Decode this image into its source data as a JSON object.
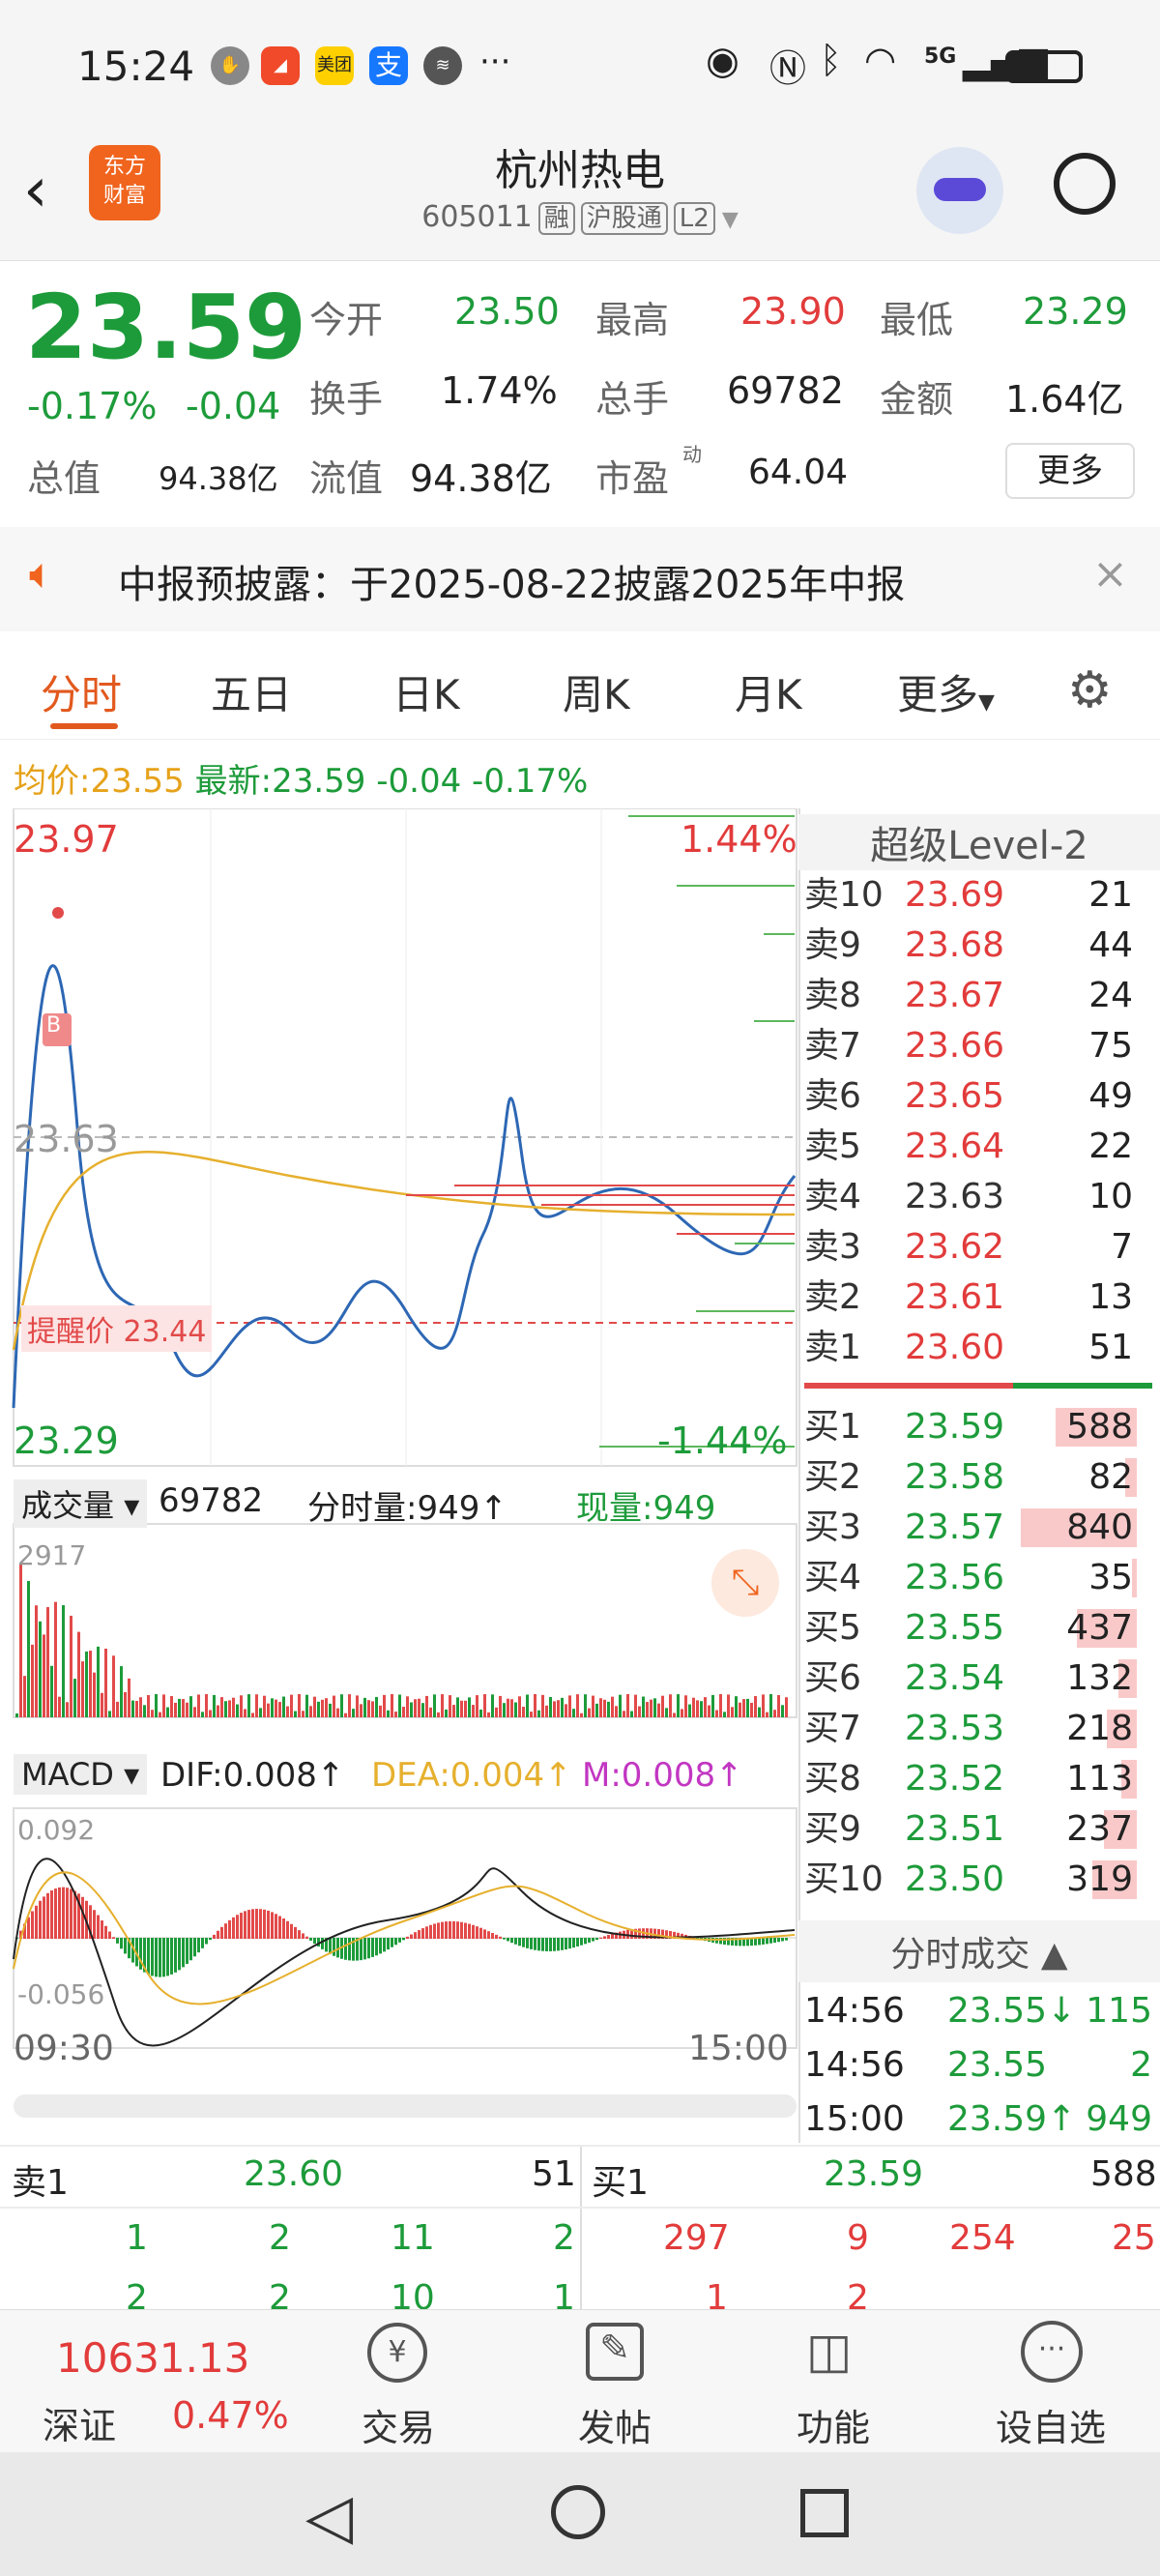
{
  "status": {
    "time": "15:24",
    "app1": "美团",
    "app2": "支",
    "net": "5G"
  },
  "header": {
    "logo": "东方\n财富",
    "title": "杭州热电",
    "code": "605011",
    "tags": [
      "融",
      "沪股通",
      "L2"
    ]
  },
  "quote": {
    "price": "23.59",
    "chg_pct": "-0.17%",
    "chg": "-0.04",
    "open_l": "今开",
    "open": "23.50",
    "high_l": "最高",
    "high": "23.90",
    "low_l": "最低",
    "low": "23.29",
    "turn_l": "换手",
    "turn": "1.74%",
    "vol_l": "总手",
    "vol": "69782",
    "amt_l": "金额",
    "amt": "1.64亿",
    "mcap_l": "总值",
    "mcap": "94.38亿",
    "fcap_l": "流值",
    "fcap": "94.38亿",
    "pe_l": "市盈",
    "pe_sup": "动",
    "pe": "64.04",
    "more": "更多"
  },
  "notice": {
    "text": "中报预披露：于2025-08-22披露2025年中报"
  },
  "tabs": [
    "分时",
    "五日",
    "日K",
    "周K",
    "月K",
    "更多"
  ],
  "avg": {
    "avg_l": "均价:",
    "avg": "23.55",
    "last_l": "最新:",
    "last": "23.59",
    "chg": "-0.04",
    "pct": "-0.17%"
  },
  "chart": {
    "ymax": "23.97",
    "ymin": "23.29",
    "ymid": "23.63",
    "pmax": "1.44%",
    "pmin": "-1.44%",
    "alert": "提醒价 23.44",
    "b": "B",
    "vol_label": "成交量",
    "vol_total": "69782",
    "fs_vol": "分时量:949↑",
    "now_vol": "现量:949",
    "vmax": "2917",
    "macd": "MACD",
    "dif": "DIF:0.008↑",
    "dea": "DEA:0.004↑",
    "m": "M:0.008↑",
    "mtop": "0.092",
    "mbot": "-0.056",
    "t0": "09:30",
    "t1": "15:00"
  },
  "level2": {
    "title": "超级Level-2",
    "asks": [
      [
        "卖10",
        "23.69",
        "21"
      ],
      [
        "卖9",
        "23.68",
        "44"
      ],
      [
        "卖8",
        "23.67",
        "24"
      ],
      [
        "卖7",
        "23.66",
        "75"
      ],
      [
        "卖6",
        "23.65",
        "49"
      ],
      [
        "卖5",
        "23.64",
        "22"
      ],
      [
        "卖4",
        "23.63",
        "10"
      ],
      [
        "卖3",
        "23.62",
        "7"
      ],
      [
        "卖2",
        "23.61",
        "13"
      ],
      [
        "卖1",
        "23.60",
        "51"
      ]
    ],
    "bids": [
      [
        "买1",
        "23.59",
        "588"
      ],
      [
        "买2",
        "23.58",
        "82"
      ],
      [
        "买3",
        "23.57",
        "840"
      ],
      [
        "买4",
        "23.56",
        "35"
      ],
      [
        "买5",
        "23.55",
        "437"
      ],
      [
        "买6",
        "23.54",
        "132"
      ],
      [
        "买7",
        "23.53",
        "218"
      ],
      [
        "买8",
        "23.52",
        "113"
      ],
      [
        "买9",
        "23.51",
        "237"
      ],
      [
        "买10",
        "23.50",
        "319"
      ]
    ],
    "ticks_title": "分时成交",
    "ticks": [
      [
        "14:56",
        "23.55↓",
        "115"
      ],
      [
        "14:56",
        "23.55",
        "2"
      ],
      [
        "15:00",
        "23.59↑",
        "949"
      ]
    ]
  },
  "queue": {
    "s_label": "卖1",
    "s_price": "23.60",
    "s_vol": "51",
    "b_label": "买1",
    "b_price": "23.59",
    "b_vol": "588",
    "s_row1": [
      "1",
      "2",
      "11",
      "2"
    ],
    "s_row2": [
      "2",
      "2",
      "10",
      "1"
    ],
    "b_row1": [
      "297",
      "9",
      "254",
      "25"
    ],
    "b_row2": [
      "1",
      "2"
    ]
  },
  "bottom": {
    "index": "10631.13",
    "index_name": "深证",
    "index_pct": "0.47%",
    "nav": [
      "交易",
      "发帖",
      "功能",
      "设自选"
    ]
  },
  "colors": {
    "up": "#e23b3b",
    "down": "#1d9b3a",
    "accent": "#f0641e"
  }
}
